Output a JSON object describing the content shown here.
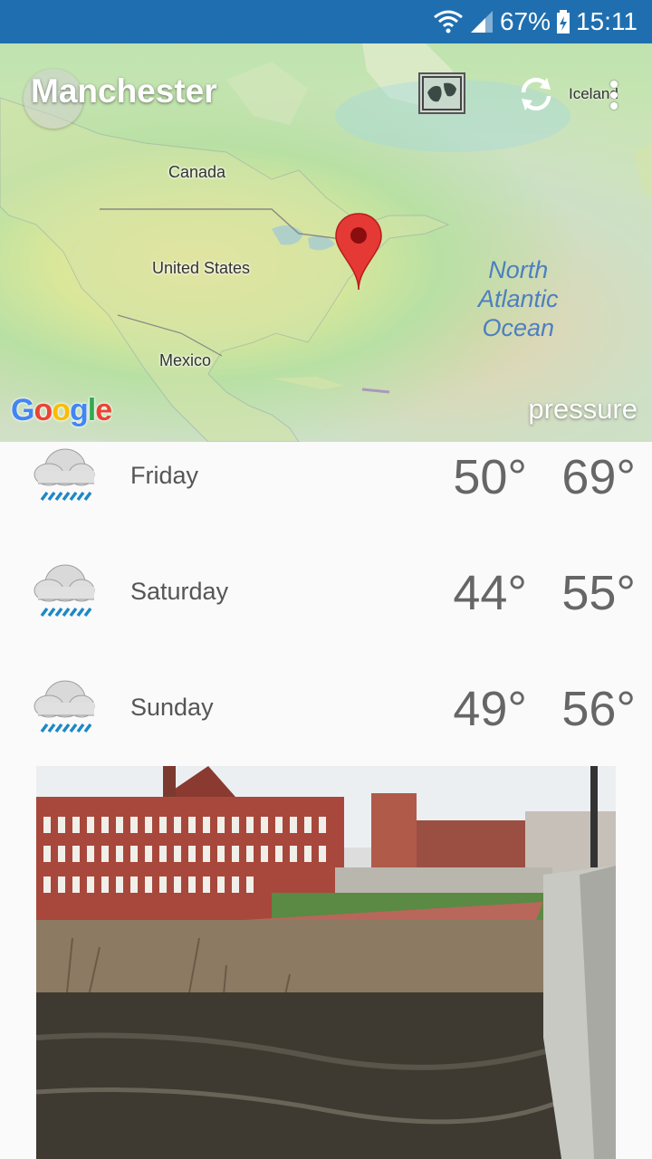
{
  "status_bar": {
    "battery": "67%",
    "time": "15:11"
  },
  "header": {
    "city": "Manchester",
    "layers_icon": "map-layers-icon",
    "refresh_icon": "refresh-icon",
    "menu_icon": "more-vert-icon"
  },
  "map": {
    "labels": {
      "canada": "Canada",
      "usa": "United States",
      "mexico": "Mexico",
      "iceland": "Iceland",
      "ocean_line1": "North",
      "ocean_line2": "Atlantic",
      "ocean_line3": "Ocean"
    },
    "google_logo": "Google",
    "overlay_mode": "pressure",
    "pin_color": "#e53935"
  },
  "forecast": [
    {
      "day": "Friday",
      "low": "50°",
      "high": "69°",
      "icon": "rain-cloud-icon"
    },
    {
      "day": "Saturday",
      "low": "44°",
      "high": "55°",
      "icon": "rain-cloud-icon"
    },
    {
      "day": "Sunday",
      "low": "49°",
      "high": "56°",
      "icon": "rain-cloud-icon"
    }
  ],
  "colors": {
    "status_bar": "#1f6fb0",
    "background": "#fafafa",
    "rain": "#1e88c7"
  }
}
